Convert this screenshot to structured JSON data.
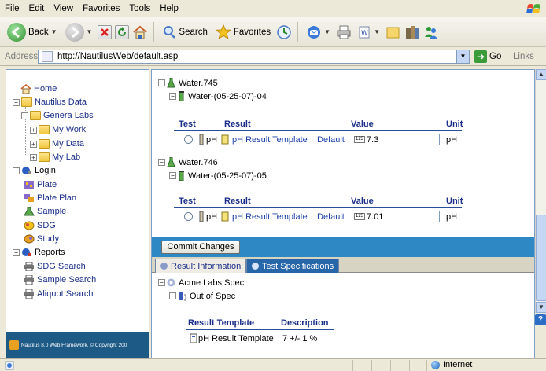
{
  "menu": [
    "File",
    "Edit",
    "View",
    "Favorites",
    "Tools",
    "Help"
  ],
  "toolbar": {
    "back_label": "Back",
    "search_label": "Search",
    "favorites_label": "Favorites"
  },
  "address": {
    "label": "Address",
    "url": "http://NautilusWeb/default.asp",
    "go_label": "Go",
    "links_label": "Links"
  },
  "nav_tree": {
    "home": "Home",
    "nautilus_data": "Nautilus Data",
    "genera_labs": "Genera Labs",
    "my_work": "My Work",
    "my_data": "My Data",
    "my_lab": "My Lab",
    "login": "Login",
    "plate": "Plate",
    "plate_plan": "Plate Plan",
    "sample": "Sample",
    "sdg": "SDG",
    "study": "Study",
    "reports": "Reports",
    "sdg_search": "SDG Search",
    "sample_search": "Sample Search",
    "aliquot_search": "Aliquot Search"
  },
  "footer_text": "Nautilus 8.0 Web Framework. © Copyright 200",
  "results": {
    "headers": {
      "test": "Test",
      "result": "Result",
      "value": "Value",
      "unit": "Unit"
    },
    "groups": [
      {
        "sample": "Water.745",
        "aliquot": "Water-(05-25-07)-04",
        "row": {
          "test": "pH",
          "result": "pH Result Template",
          "result_default": "Default",
          "value": "7.3",
          "unit": "pH"
        }
      },
      {
        "sample": "Water.746",
        "aliquot": "Water-(05-25-07)-05",
        "row": {
          "test": "pH",
          "result": "pH Result Template",
          "result_default": "Default",
          "value": "7.01",
          "unit": "pH"
        }
      }
    ]
  },
  "commit_label": "Commit Changes",
  "tabs": {
    "result_information": "Result Information",
    "test_specifications": "Test Specifications"
  },
  "spec": {
    "root": "Acme Labs Spec",
    "child": "Out of Spec",
    "headers": {
      "result_template": "Result Template",
      "description": "Description"
    },
    "row": {
      "result_template": "pH Result Template",
      "description": "7 +/- 1 %"
    }
  },
  "status": {
    "zone": "Internet"
  },
  "colors": {
    "link": "#1b3fa8",
    "header_text": "#1b2f8a",
    "blue_bar": "#2e88c4",
    "active_tab": "#2766a8",
    "footer": "#1d5a86"
  }
}
